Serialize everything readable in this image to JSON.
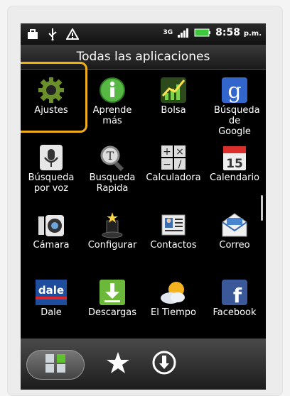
{
  "status_bar": {
    "network": "3G",
    "time": "8:58",
    "ampm": "p.m."
  },
  "title": "Todas las aplicaciones",
  "apps": [
    {
      "label": "Ajustes",
      "icon": "gear-icon",
      "highlighted": true
    },
    {
      "label": "Aprende más",
      "icon": "info-icon"
    },
    {
      "label": "Bolsa",
      "icon": "stock-chart-icon"
    },
    {
      "label": "Búsqueda de Google",
      "icon": "google-g-icon"
    },
    {
      "label": "Búsqueda por voz",
      "icon": "microphone-icon"
    },
    {
      "label": "Busqueda Rapida",
      "icon": "magnifier-icon"
    },
    {
      "label": "Calculadora",
      "icon": "calculator-icon"
    },
    {
      "label": "Calendario",
      "icon": "calendar-icon",
      "badge": "15"
    },
    {
      "label": "Cámara",
      "icon": "camera-icon"
    },
    {
      "label": "Configurar",
      "icon": "magic-hat-icon"
    },
    {
      "label": "Contactos",
      "icon": "contacts-card-icon"
    },
    {
      "label": "Correo",
      "icon": "mail-envelope-icon"
    },
    {
      "label": "Dale",
      "icon": "dale-logo-icon",
      "logo_text": "dale"
    },
    {
      "label": "Descargas",
      "icon": "download-icon"
    },
    {
      "label": "El Tiempo",
      "icon": "weather-icon"
    },
    {
      "label": "Facebook",
      "icon": "facebook-icon",
      "logo_text": "f"
    }
  ],
  "dock": [
    {
      "name": "all-apps-button",
      "icon": "grid-icon"
    },
    {
      "name": "favorites-button",
      "icon": "star-icon"
    },
    {
      "name": "downloads-button",
      "icon": "download-circle-icon"
    }
  ],
  "colors": {
    "highlight": "#f1ae1a",
    "facebook": "#3b5998",
    "google": "#3366cc"
  }
}
